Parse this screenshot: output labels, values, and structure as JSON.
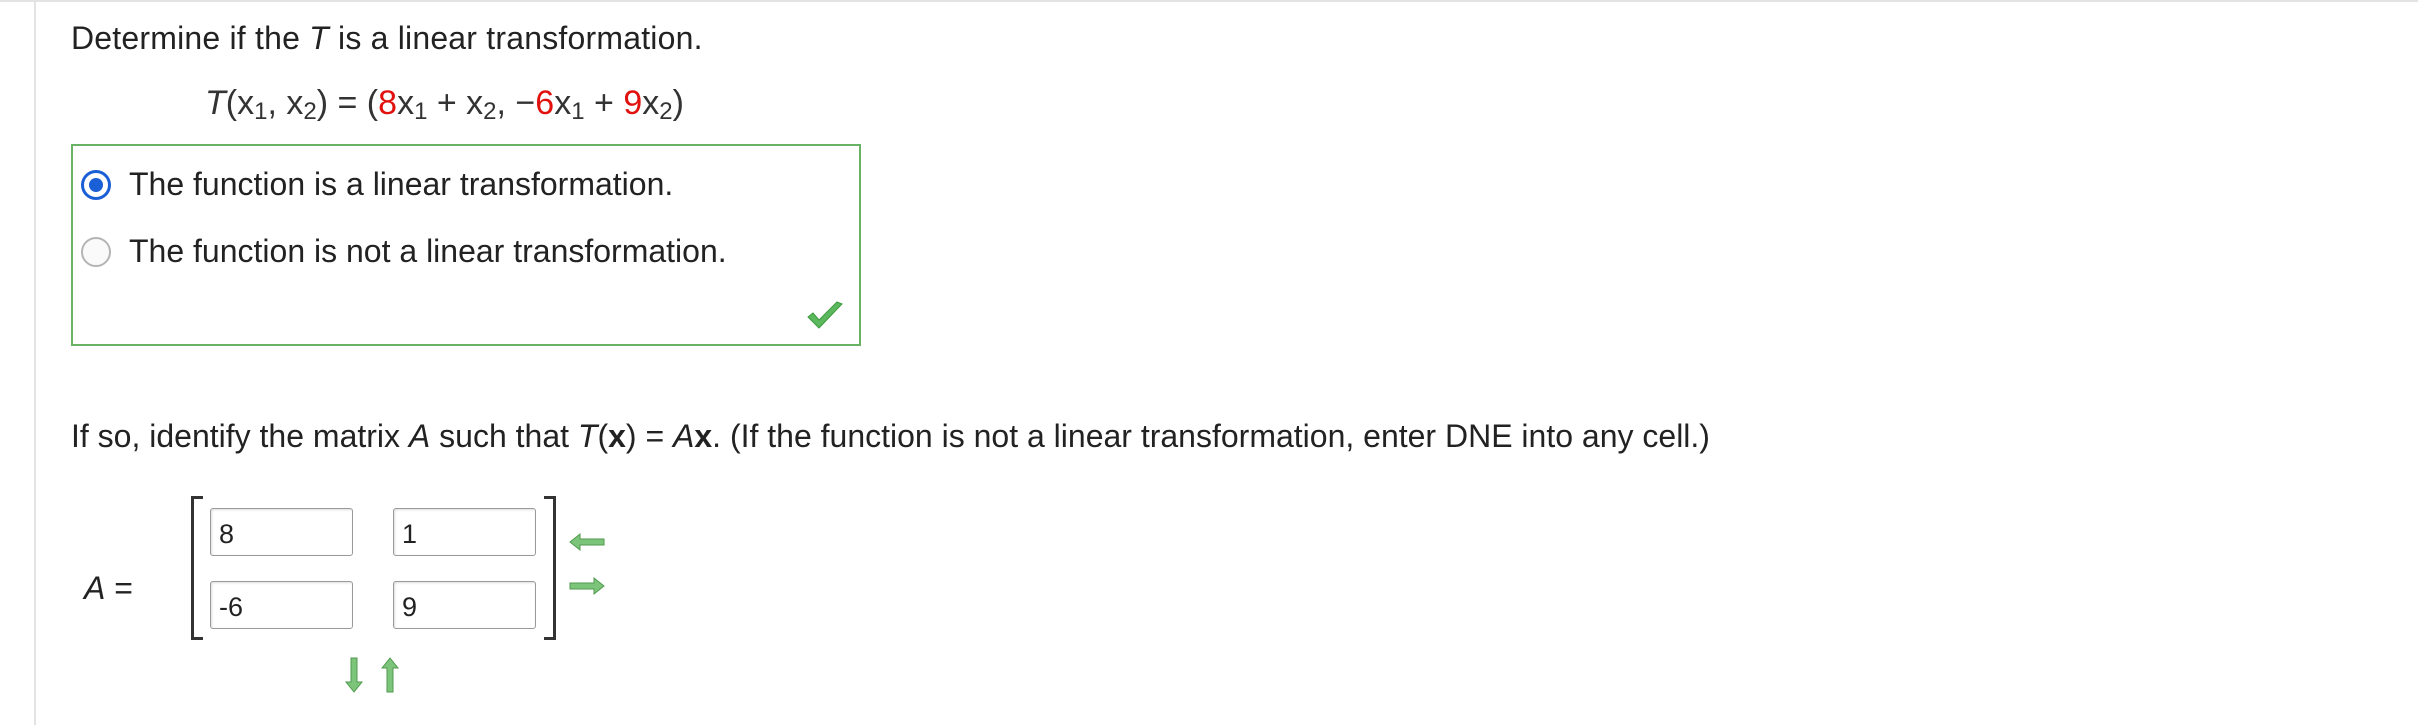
{
  "question": {
    "prefix": "Determine if the ",
    "var": "T",
    "suffix": " is a linear transformation."
  },
  "equation": {
    "lhs_T": "T",
    "lhs_args_open": "(x",
    "sub1": "1",
    "comma": ", x",
    "sub2": "2",
    "lhs_close": ")",
    "equals": " = (",
    "a11": "8",
    "x1a": "x",
    "plus1": " + x",
    "comma2": ", −",
    "a21": "6",
    "x1b": "x",
    "plus2": " + ",
    "a22": "9",
    "x2b": "x",
    "end": ")"
  },
  "options": [
    {
      "label": "The function is a linear transformation.",
      "selected": true
    },
    {
      "label": "The function is not a linear transformation.",
      "selected": false
    }
  ],
  "feedback": {
    "status": "correct",
    "icon": "checkmark-icon",
    "color": "#5cb85c"
  },
  "prompt": {
    "p1": "If so, identify the matrix ",
    "A": "A",
    "p2": " such that  ",
    "T": "T",
    "p3": "(",
    "x": "x",
    "p4": ") = ",
    "A2": "A",
    "x2": "x",
    "p5": ".  (If the function is not a linear transformation, enter DNE into any cell.)"
  },
  "matrix": {
    "label_var": "A",
    "label_eq": " =",
    "cells": [
      [
        "8",
        "1"
      ],
      [
        "-6",
        "9"
      ]
    ]
  },
  "colors": {
    "accent": "#1b5fd6",
    "highlight_red": "#e1120d",
    "correct_border": "#69b464",
    "arrow_green": "#5cb85c"
  }
}
